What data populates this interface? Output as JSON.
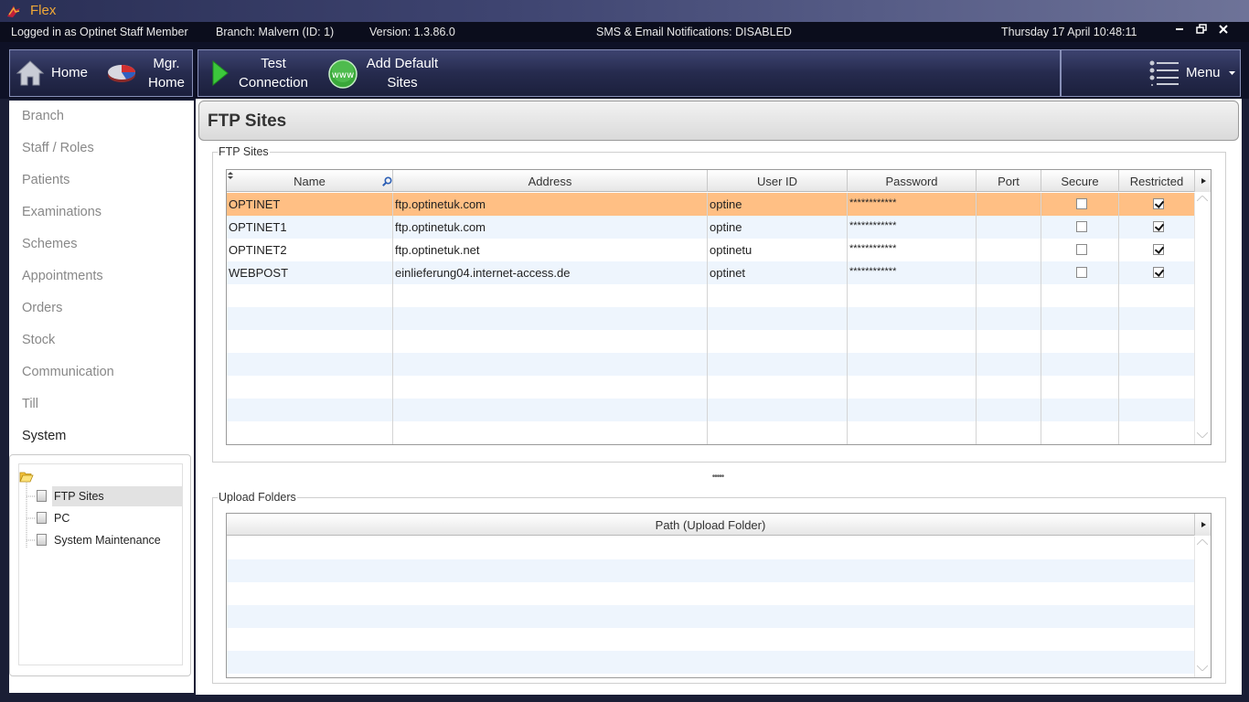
{
  "app": {
    "title": "Flex"
  },
  "status": {
    "user": "Logged in as Optinet Staff Member",
    "branch": "Branch: Malvern (ID:  1)",
    "version": "Version: 1.3.86.0",
    "notifications": "SMS & Email Notifications: DISABLED",
    "datetime": "Thursday 17 April 10:48:11"
  },
  "toolbar": {
    "home": "Home",
    "mgr_home_1": "Mgr.",
    "mgr_home_2": "Home",
    "test_1": "Test",
    "test_2": "Connection",
    "add_1": "Add Default",
    "add_2": "Sites",
    "menu": "Menu",
    "www_icon_text": "www"
  },
  "nav": {
    "items": [
      "Branch",
      "Staff / Roles",
      "Patients",
      "Examinations",
      "Schemes",
      "Appointments",
      "Orders",
      "Stock",
      "Communication",
      "Till",
      "System"
    ],
    "active": "System",
    "tree": [
      "FTP Sites",
      "PC",
      "System Maintenance"
    ],
    "tree_selected": "FTP Sites"
  },
  "page": {
    "title": "FTP Sites"
  },
  "ftp": {
    "legend": "FTP Sites",
    "columns": [
      "Name",
      "Address",
      "User ID",
      "Password",
      "Port",
      "Secure",
      "Restricted"
    ],
    "rows": [
      {
        "name": "OPTINET",
        "address": "ftp.optinetuk.com",
        "user": "optine",
        "password": "************",
        "port": "",
        "secure": false,
        "restricted": true
      },
      {
        "name": "OPTINET1",
        "address": "ftp.optinetuk.com",
        "user": "optine",
        "password": "************",
        "port": "",
        "secure": false,
        "restricted": true
      },
      {
        "name": "OPTINET2",
        "address": "ftp.optinetuk.net",
        "user": "optinetu",
        "password": "************",
        "port": "",
        "secure": false,
        "restricted": true
      },
      {
        "name": "WEBPOST",
        "address": "einlieferung04.internet-access.de",
        "user": "optinet",
        "password": "************",
        "port": "",
        "secure": false,
        "restricted": true
      }
    ],
    "selected_row": 0
  },
  "splitter": "•••••",
  "upload": {
    "legend": "Upload Folders",
    "columns": [
      "Path (Upload Folder)"
    ],
    "rows": []
  },
  "colors": {
    "accent_orange": "#ffbf84",
    "title_orange": "#f0a838",
    "alt_row": "#eef5fd",
    "toolbar_dark": "#0e1126"
  }
}
